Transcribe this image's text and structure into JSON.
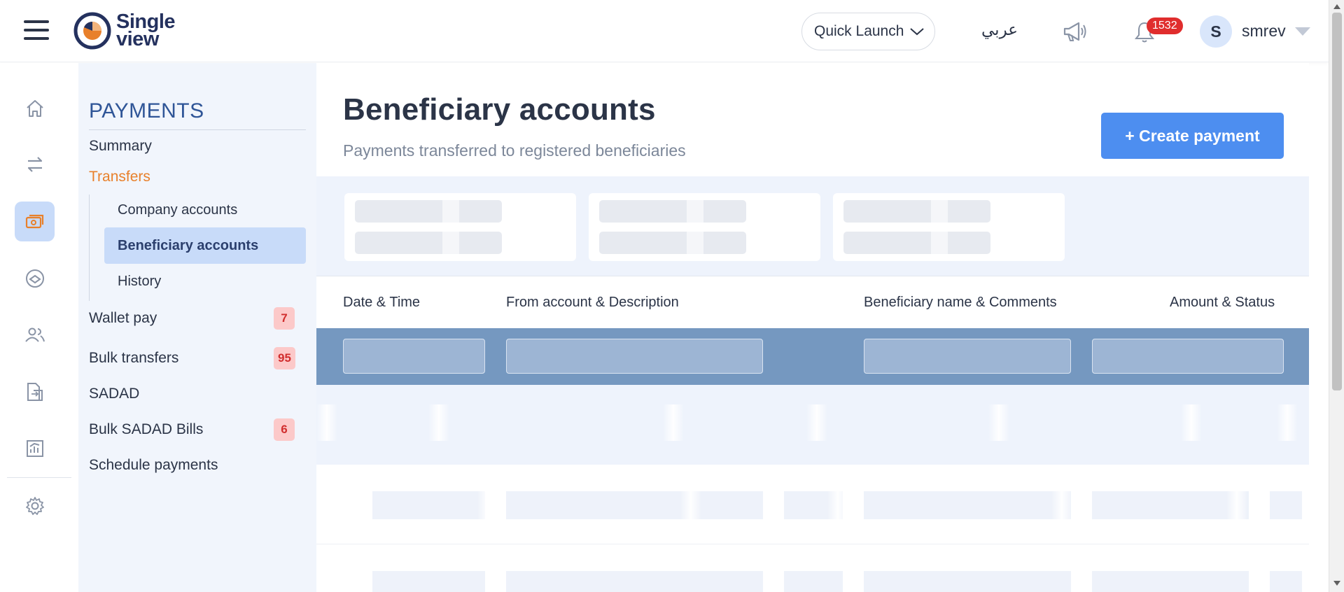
{
  "topbar": {
    "logo_line1": "Single",
    "logo_line2": "view",
    "quick_launch": "Quick Launch",
    "language": "عربي",
    "notifications_count": "1532",
    "avatar_initial": "S",
    "username": "smrev"
  },
  "rail": {
    "icons": [
      "home-icon",
      "transfer-icon",
      "payments-icon",
      "coins-icon",
      "users-icon",
      "documents-icon",
      "reports-icon",
      "settings-icon"
    ],
    "active": "payments-icon"
  },
  "nav": {
    "heading": "PAYMENTS",
    "summary": "Summary",
    "transfers": "Transfers",
    "sub_items": [
      "Company accounts",
      "Beneficiary accounts",
      "History"
    ],
    "wallet_pay": "Wallet pay",
    "wallet_pay_badge": "7",
    "bulk_transfers": "Bulk transfers",
    "bulk_transfers_badge": "95",
    "sadad": "SADAD",
    "bulk_sadad": "Bulk SADAD Bills",
    "bulk_sadad_badge": "6",
    "schedule_payments": "Schedule payments"
  },
  "main": {
    "title": "Beneficiary accounts",
    "subtitle": "Payments transferred to registered beneficiaries",
    "create_button": "+ Create payment",
    "columns": [
      "Date & Time",
      "From account & Description",
      "Beneficiary name & Comments",
      "Amount & Status"
    ]
  },
  "colors": {
    "accent": "#4d8ef0",
    "nav_active": "#c8dbf9",
    "nav_open": "#e8802b",
    "heading": "#2f5597",
    "filter_band": "#7598c0",
    "badge_bg": "#fcc9c9",
    "badge_text": "#d12e2e",
    "notif_badge": "#e02d2d"
  }
}
